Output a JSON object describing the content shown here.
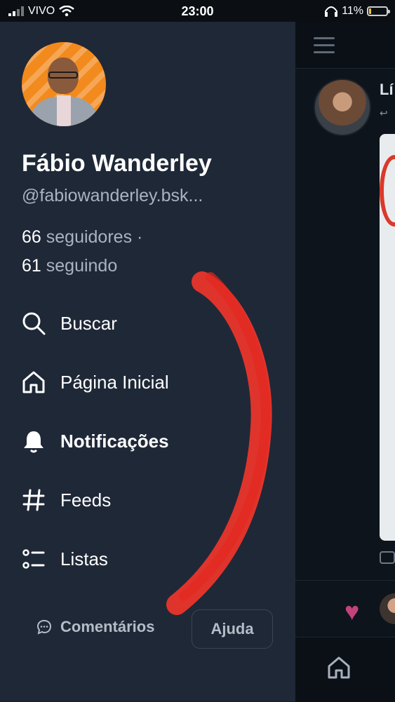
{
  "status_bar": {
    "carrier": "VIVO",
    "time": "23:00",
    "battery": "11%",
    "battery_level": 0.11
  },
  "profile": {
    "name": "Fábio Wanderley",
    "handle": "@fabiowanderley.bsk...",
    "followers_count": "66",
    "followers_label": "seguidores ·",
    "following_count": "61",
    "following_label": "seguindo"
  },
  "menu": {
    "items": [
      {
        "label": "Buscar",
        "icon": "search-icon"
      },
      {
        "label": "Página Inicial",
        "icon": "home-icon"
      },
      {
        "label": "Notificações",
        "icon": "bell-icon"
      },
      {
        "label": "Feeds",
        "icon": "hash-icon"
      },
      {
        "label": "Listas",
        "icon": "list-icon"
      }
    ]
  },
  "footer": {
    "feedback_label": "Comentários",
    "help_label": "Ajuda"
  },
  "background_feed": {
    "author_name_partial": "Lí"
  },
  "colors": {
    "drawer_bg": "#1f2837",
    "annotation_scribble": "#f0352b",
    "heart": "#c2437c"
  }
}
